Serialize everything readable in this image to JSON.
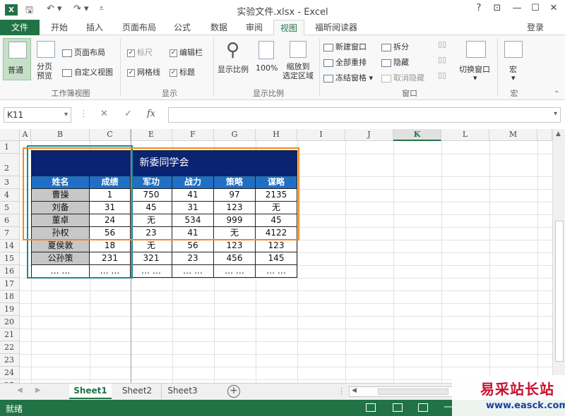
{
  "window": {
    "title": "实验文件.xlsx - Excel",
    "logo": "X",
    "controls": [
      "?",
      "⊡",
      "—",
      "☐",
      "✕"
    ]
  },
  "ribbon_tabs": {
    "file": "文件",
    "tabs": [
      "开始",
      "插入",
      "页面布局",
      "公式",
      "数据",
      "审阅",
      "视图",
      "福昕阅读器"
    ],
    "active": "视图",
    "login": "登录"
  },
  "ribbon": {
    "workbook_views": {
      "label": "工作簿视图",
      "normal": "普通",
      "page_break": "分页\n预览",
      "page_layout": "页面布局",
      "custom_views": "自定义视图"
    },
    "show": {
      "label": "显示",
      "ruler": "标尺",
      "formula_bar": "编辑栏",
      "gridlines": "网格线",
      "headings": "标题"
    },
    "zoom": {
      "label": "显示比例",
      "zoom": "显示比例",
      "hundred": "100%",
      "zoom_to_selection": "缩放到\n选定区域"
    },
    "window": {
      "label": "窗口",
      "new_window": "新建窗口",
      "arrange_all": "全部重排",
      "freeze_panes": "冻结窗格",
      "split": "拆分",
      "hide": "隐藏",
      "unhide": "取消隐藏",
      "switch_windows": "切换窗口"
    },
    "macros": {
      "label": "宏",
      "macros": "宏"
    }
  },
  "formula_bar": {
    "name_box": "K11",
    "cancel": "✕",
    "enter": "✓",
    "fx": "fx",
    "value": ""
  },
  "grid": {
    "columns": [
      "A",
      "B",
      "C",
      "E",
      "F",
      "G",
      "H",
      "I",
      "J",
      "K",
      "L",
      "M"
    ],
    "selected_column": "K",
    "rows": [
      "1",
      "2",
      "3",
      "4",
      "5",
      "6",
      "7",
      "14",
      "15",
      "16",
      "17",
      "18",
      "19",
      "20",
      "21",
      "22",
      "23",
      "24",
      "25"
    ],
    "title": "新委同学会",
    "headers": [
      "姓名",
      "成绩",
      "军功",
      "战力",
      "策略",
      "谋略"
    ],
    "data": [
      [
        "曹操",
        "1",
        "750",
        "41",
        "97",
        "2135"
      ],
      [
        "刘备",
        "31",
        "45",
        "31",
        "123",
        "无"
      ],
      [
        "董卓",
        "24",
        "无",
        "534",
        "999",
        "45"
      ],
      [
        "孙权",
        "56",
        "23",
        "41",
        "无",
        "4122"
      ],
      [
        "夏侯敦",
        "18",
        "无",
        "56",
        "123",
        "123"
      ],
      [
        "公孙策",
        "231",
        "321",
        "23",
        "456",
        "145"
      ],
      [
        "…  …",
        "… …",
        "… …",
        "… …",
        "… …",
        "… …"
      ]
    ]
  },
  "sheets": {
    "tabs": [
      "Sheet1",
      "Sheet2",
      "Sheet3"
    ],
    "active": "Sheet1",
    "add": "+"
  },
  "status": {
    "text": "就绪"
  },
  "watermark": {
    "cn": "易采站长站",
    "url": "www.easck.com"
  },
  "colors": {
    "excel_green": "#217346",
    "title_fill": "#0a2472",
    "header_fill": "#1f6fc6",
    "gray_fill": "#c7c7c7",
    "orange_box": "#f08a24",
    "teal_box": "#1b8a8a"
  }
}
